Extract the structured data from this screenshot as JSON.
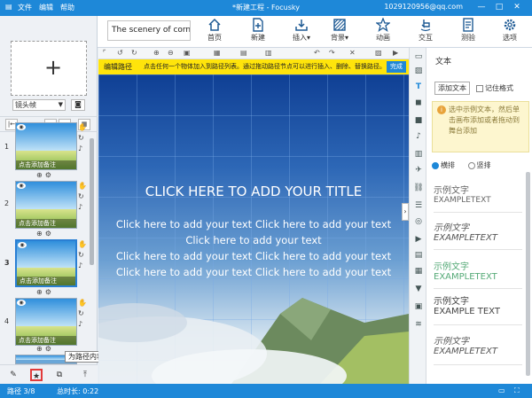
{
  "titlebar": {
    "title": "*新建工程 - Focusky",
    "menus": [
      "文件",
      "编辑",
      "帮助"
    ],
    "email": "1029120956@qq.com",
    "min": "—",
    "max": "□",
    "close": "✕"
  },
  "toolbar": {
    "project_name": "The scenery of corn",
    "buttons": [
      "首页",
      "新建",
      "插入▾",
      "背景▾",
      "动画",
      "交互",
      "测验",
      "选项"
    ]
  },
  "left": {
    "lens_select": "镜头帧",
    "slides": [
      {
        "num": "1",
        "caption": "点击添加备注"
      },
      {
        "num": "2",
        "caption": "点击添加备注"
      },
      {
        "num": "3",
        "caption": "点击添加备注"
      },
      {
        "num": "4",
        "caption": "点击添加备注"
      },
      {
        "num": "5",
        "caption": ""
      }
    ],
    "tooltip": "为路径内容添加动画效果"
  },
  "pathbar": {
    "label": "编辑路径",
    "hint": "点击任何一个物体加入到路径列表。通过拖动路径节点可以进行插入、删除、替换路径。",
    "done": "完成"
  },
  "canvas": {
    "title": "CLICK HERE TO ADD YOUR TITLE",
    "lines": [
      "Click here to add your text Click here to add your text",
      "Click here to add your text",
      "Click here to add your text Click here to add your text",
      "Click here to add your text Click here to add your text"
    ]
  },
  "right": {
    "title": "文本",
    "add_text": "添加文本",
    "remember": "记住格式",
    "tip": "选中示例文本，然后单击画布添加或者拖动到舞台添加",
    "horizontal": "横排",
    "vertical": "竖排",
    "samples": [
      {
        "cn": "示例文字",
        "en": "EXAMPLETEXT"
      },
      {
        "cn": "示例文字",
        "en": "EXAMPLETEXT"
      },
      {
        "cn": "示例文字",
        "en": "EXAMPLETEXT"
      },
      {
        "cn": "示例文字",
        "en": "EXAMPLE TEXT"
      },
      {
        "cn": "示例文字",
        "en": "EXAMPLETEXT"
      }
    ]
  },
  "status": {
    "path": "路径 3/8",
    "duration": "总时长: 0:22"
  },
  "colors": {
    "accent": "#1e88d8",
    "pathbar": "#ffe40b",
    "highlight": "#e23b3b"
  }
}
